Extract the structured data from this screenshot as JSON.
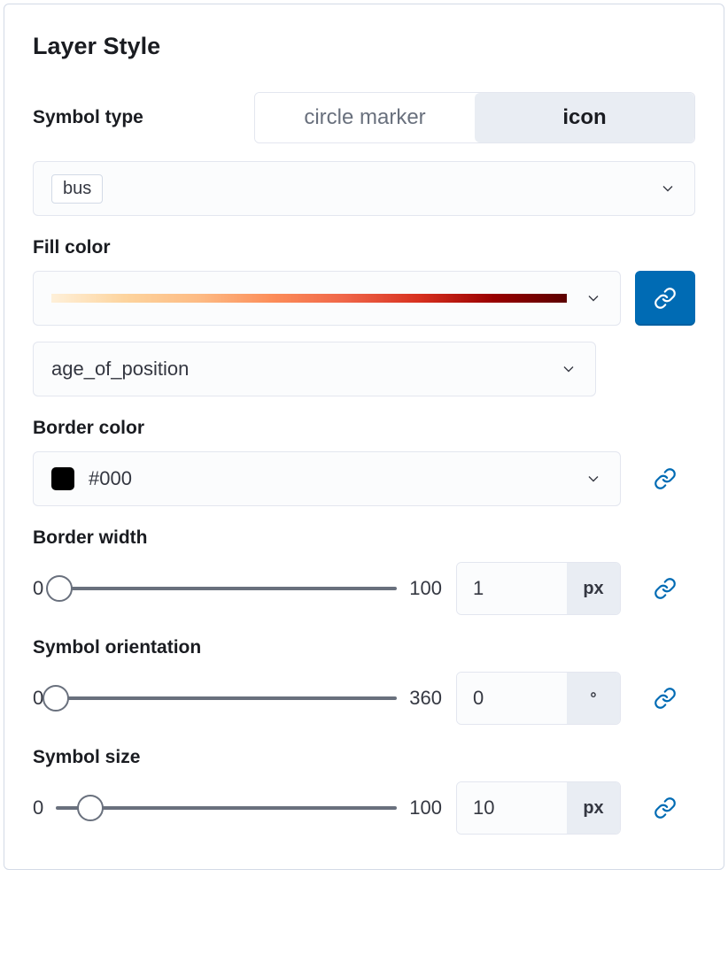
{
  "title": "Layer Style",
  "symbolType": {
    "label": "Symbol type",
    "options": [
      "circle marker",
      "icon"
    ],
    "selected": "icon"
  },
  "iconSelect": {
    "value": "bus"
  },
  "fillColor": {
    "label": "Fill color",
    "linkActive": true,
    "dataField": "age_of_position"
  },
  "borderColor": {
    "label": "Border color",
    "value": "#000",
    "swatch": "#000000",
    "linkActive": false
  },
  "borderWidth": {
    "label": "Border width",
    "min": "0",
    "max": "100",
    "value": "1",
    "unit": "px",
    "thumbPercent": 1,
    "linkActive": false
  },
  "symbolOrientation": {
    "label": "Symbol orientation",
    "min": "0",
    "max": "360",
    "value": "0",
    "unit": "°",
    "thumbPercent": 0,
    "linkActive": false
  },
  "symbolSize": {
    "label": "Symbol size",
    "min": "0",
    "max": "100",
    "value": "10",
    "unit": "px",
    "thumbPercent": 10,
    "linkActive": false
  }
}
